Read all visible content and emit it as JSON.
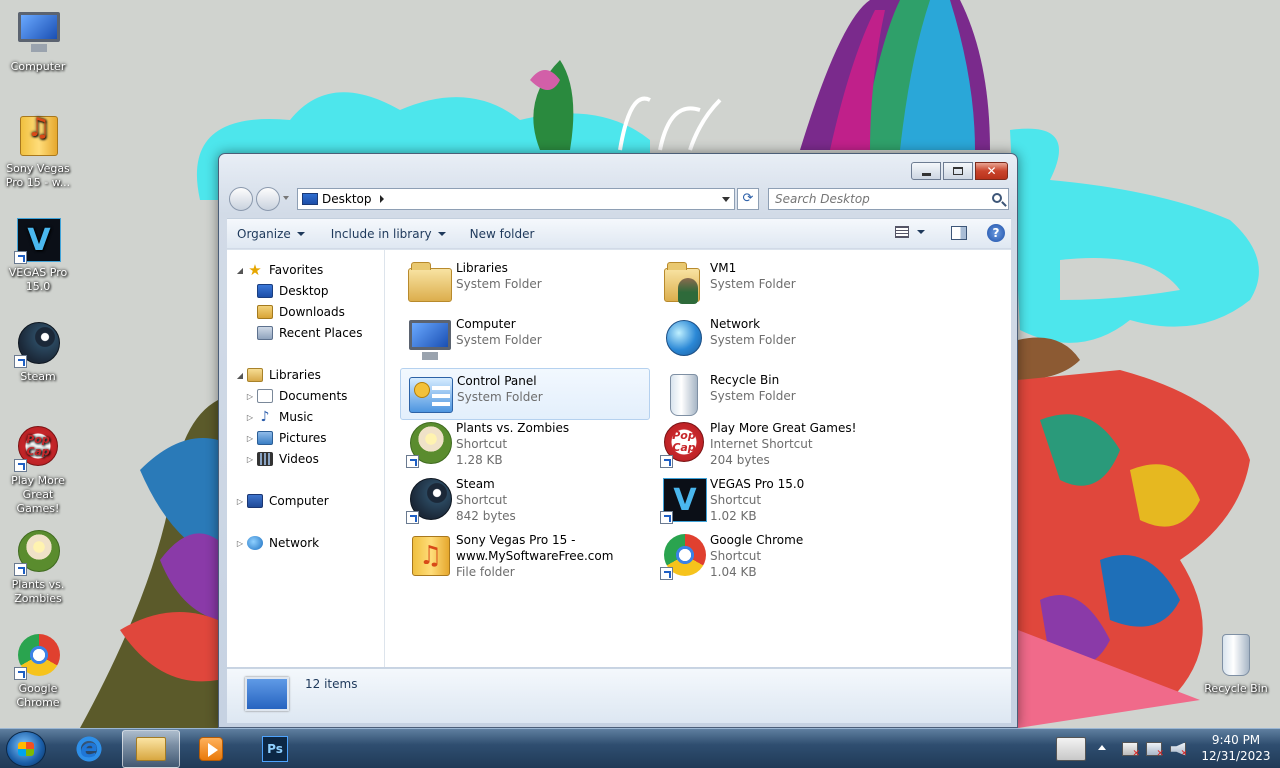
{
  "desktop": {
    "icons": [
      {
        "label": "Computer"
      },
      {
        "label": "Sony Vegas Pro 15 - w..."
      },
      {
        "label": "VEGAS Pro 15.0"
      },
      {
        "label": "Steam"
      },
      {
        "label": "Play More Great Games!"
      },
      {
        "label": "Plants vs. Zombies"
      },
      {
        "label": "Google Chrome"
      },
      {
        "label": "Recycle Bin"
      }
    ]
  },
  "window": {
    "address": {
      "crumb": "Desktop"
    },
    "search": {
      "placeholder": "Search Desktop"
    },
    "toolbar": {
      "organize": "Organize",
      "include": "Include in library",
      "new_folder": "New folder"
    },
    "nav": {
      "favorites": "Favorites",
      "desktop": "Desktop",
      "downloads": "Downloads",
      "recent": "Recent Places",
      "libraries": "Libraries",
      "documents": "Documents",
      "music": "Music",
      "pictures": "Pictures",
      "videos": "Videos",
      "computer": "Computer",
      "network": "Network"
    },
    "files": [
      {
        "name": "Libraries",
        "type": "System Folder"
      },
      {
        "name": "VM1",
        "type": "System Folder"
      },
      {
        "name": "Computer",
        "type": "System Folder"
      },
      {
        "name": "Network",
        "type": "System Folder"
      },
      {
        "name": "Control Panel",
        "type": "System Folder"
      },
      {
        "name": "Recycle Bin",
        "type": "System Folder"
      },
      {
        "name": "Plants vs. Zombies",
        "type": "Shortcut",
        "size": "1.28 KB"
      },
      {
        "name": "Play More Great Games!",
        "type": "Internet Shortcut",
        "size": "204 bytes"
      },
      {
        "name": "Steam",
        "type": "Shortcut",
        "size": "842 bytes"
      },
      {
        "name": "VEGAS Pro 15.0",
        "type": "Shortcut",
        "size": "1.02 KB"
      },
      {
        "name": "Sony Vegas Pro 15 -",
        "name2": "www.MySoftwareFree.com",
        "type": "File folder"
      },
      {
        "name": "Google Chrome",
        "type": "Shortcut",
        "size": "1.04 KB"
      }
    ],
    "details": {
      "count": "12 items"
    }
  },
  "taskbar": {
    "clock": {
      "time": "9:40 PM",
      "date": "12/31/2023"
    },
    "vegas_letter": "V",
    "ps_label": "Ps",
    "popcap_label": "Pop Cap"
  }
}
